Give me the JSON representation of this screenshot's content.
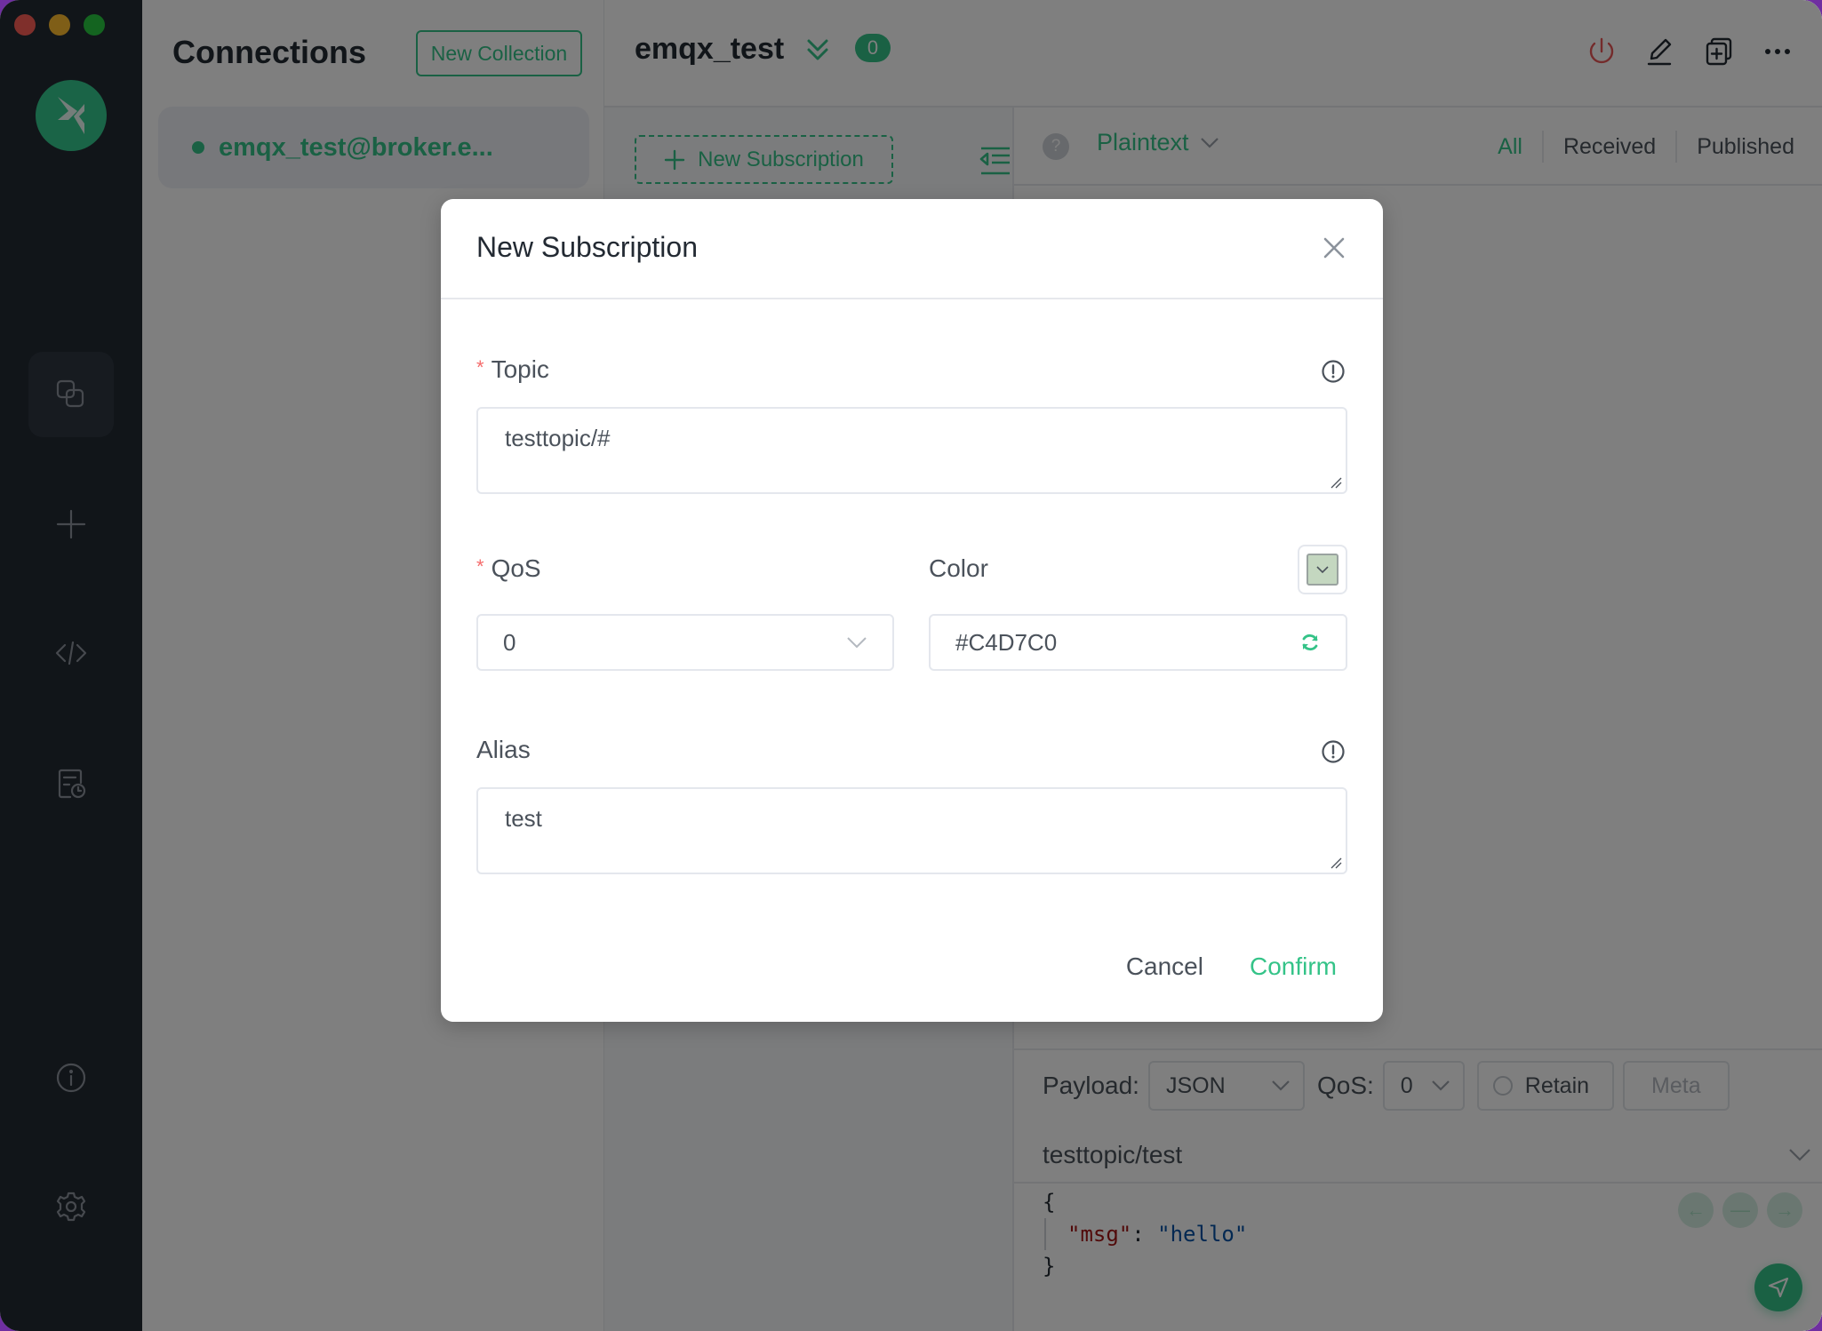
{
  "window": {
    "traffic_lights": [
      "close",
      "minimize",
      "maximize"
    ]
  },
  "colors": {
    "accent": "#34C388",
    "nav_bg": "#232A33",
    "required": "#F56C6C",
    "subscription_color": "#C4D7C0"
  },
  "nav": {
    "logo": "mqttx-logo",
    "items": [
      {
        "icon": "connections-icon",
        "active": true
      },
      {
        "icon": "plus-icon",
        "active": false
      },
      {
        "icon": "code-icon",
        "active": false
      },
      {
        "icon": "log-icon",
        "active": false
      },
      {
        "icon": "info-icon",
        "active": false
      },
      {
        "icon": "gear-icon",
        "active": false
      }
    ]
  },
  "connections": {
    "title": "Connections",
    "new_collection_label": "New Collection",
    "items": [
      {
        "name": "emqx_test@broker.e...",
        "status": "connected"
      }
    ]
  },
  "header": {
    "title": "emqx_test",
    "unread_count": "0",
    "actions": [
      "power-icon",
      "edit-icon",
      "new-window-icon",
      "more-icon"
    ]
  },
  "subscriptions": {
    "new_subscription_label": "New Subscription"
  },
  "messages": {
    "help_glyph": "?",
    "format": "Plaintext",
    "tabs": [
      {
        "label": "All",
        "active": true
      },
      {
        "label": "Received",
        "active": false
      },
      {
        "label": "Published",
        "active": false
      }
    ]
  },
  "publish": {
    "payload_label": "Payload:",
    "payload_format": "JSON",
    "qos_label": "QoS:",
    "qos_value": "0",
    "retain_label": "Retain",
    "meta_label": "Meta",
    "topic": "testtopic/test",
    "payload": {
      "open": "{",
      "key": "\"msg\"",
      "sep": ": ",
      "value": "\"hello\"",
      "close": "}"
    }
  },
  "modal": {
    "title": "New Subscription",
    "topic_label": "Topic",
    "topic_value": "testtopic/#",
    "qos_label": "QoS",
    "qos_value": "0",
    "color_label": "Color",
    "color_value": "#C4D7C0",
    "alias_label": "Alias",
    "alias_value": "test",
    "required_mark": "*",
    "cancel_label": "Cancel",
    "confirm_label": "Confirm"
  }
}
